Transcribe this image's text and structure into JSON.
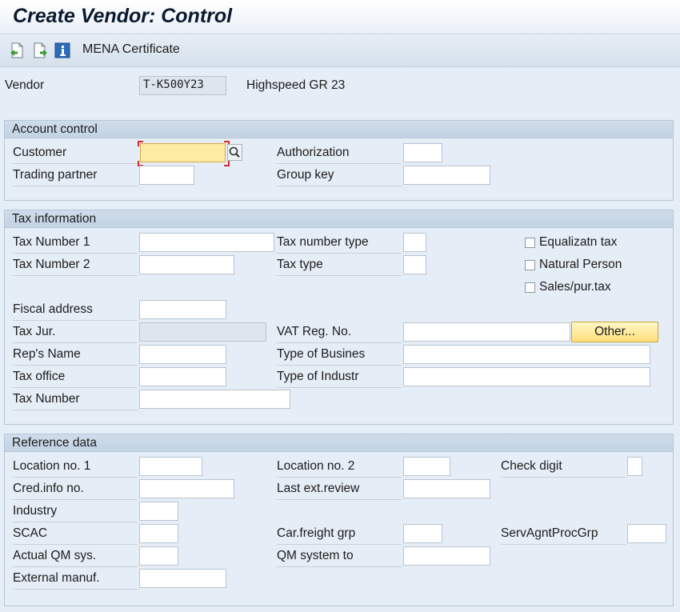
{
  "title": "Create Vendor: Control",
  "toolbar": {
    "icons": [
      "prev-screen-icon",
      "next-screen-icon",
      "info-icon"
    ],
    "mena_label": "MENA Certificate"
  },
  "vendor": {
    "label": "Vendor",
    "id": "T-K500Y23",
    "name": "Highspeed GR 23"
  },
  "account_control": {
    "header": "Account control",
    "customer_label": "Customer",
    "customer_value": "",
    "trading_partner_label": "Trading partner",
    "authorization_label": "Authorization",
    "group_key_label": "Group key"
  },
  "tax_information": {
    "header": "Tax information",
    "tax_number_1": "Tax Number 1",
    "tax_number_2": "Tax Number 2",
    "fiscal_address": "Fiscal address",
    "tax_jur": "Tax Jur.",
    "reps_name": "Rep's Name",
    "tax_office": "Tax office",
    "tax_number": "Tax Number",
    "tax_number_type": "Tax number type",
    "tax_type": "Tax type",
    "vat_reg_no": "VAT Reg. No.",
    "type_of_business": "Type of Busines",
    "type_of_industry": "Type of Industr",
    "other_button": "Other...",
    "checkboxes": {
      "equalization_tax": "Equalizatn tax",
      "natural_person": "Natural Person",
      "sales_pur_tax": "Sales/pur.tax"
    }
  },
  "reference_data": {
    "header": "Reference data",
    "location_no_1": "Location no. 1",
    "cred_info_no": "Cred.info no.",
    "industry": "Industry",
    "scac": "SCAC",
    "actual_qm_sys": "Actual QM sys.",
    "external_manuf": "External manuf.",
    "location_no_2": "Location no. 2",
    "last_ext_review": "Last ext.review",
    "car_freight_grp": "Car.freight grp",
    "qm_system_to": "QM system to",
    "check_digit": "Check digit",
    "serv_agnt_proc_grp": "ServAgntProcGrp"
  }
}
